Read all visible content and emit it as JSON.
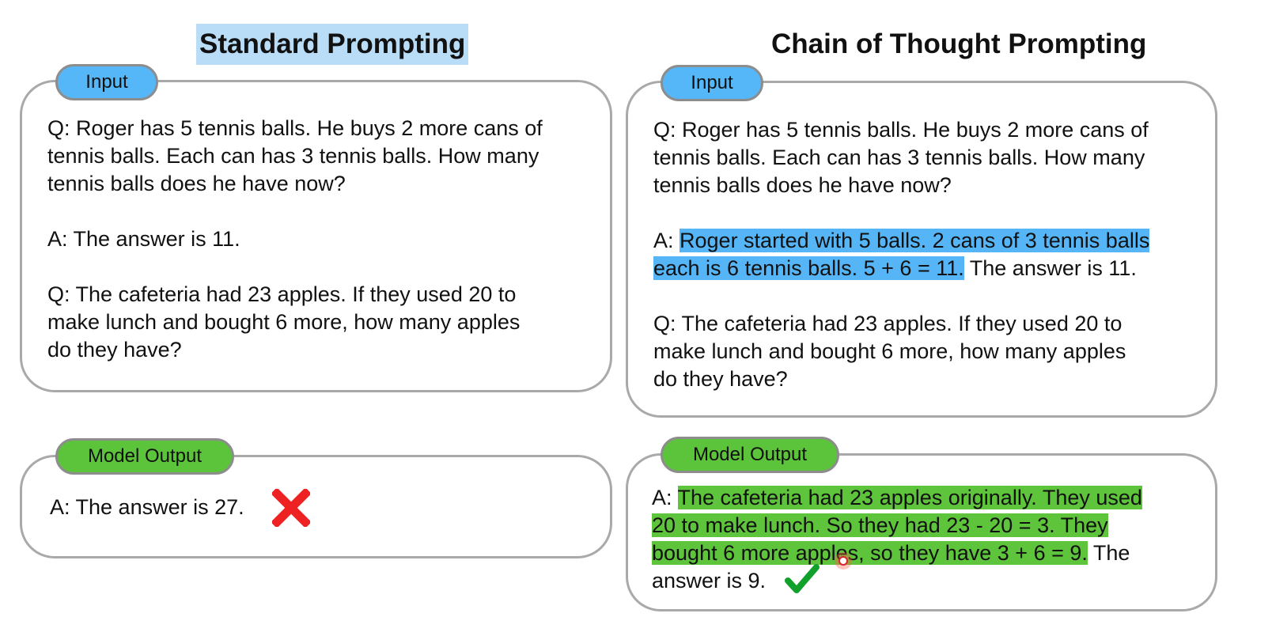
{
  "standard": {
    "title": "Standard Prompting",
    "title_highlight_color": "#b9dcf7",
    "input_tag": "Input",
    "input_lines": [
      "Q: Roger has 5 tennis balls. He buys 2 more cans of",
      "tennis balls. Each can has 3 tennis balls. How many",
      "tennis balls does he have now?",
      "",
      "A: The answer is 11.",
      "",
      "Q: The cafeteria had 23 apples. If they used 20 to",
      "make lunch and bought 6 more, how many apples",
      "do they have?"
    ],
    "output_tag": "Model Output",
    "output_text": "A: The answer is 27.",
    "output_mark_icon": "red-cross-icon"
  },
  "cot": {
    "title": "Chain of Thought Prompting",
    "input_tag": "Input",
    "q1_lines": [
      "Q: Roger has 5 tennis balls. He buys 2 more cans of",
      "tennis balls. Each can has 3 tennis balls. How many",
      "tennis balls does he have now?"
    ],
    "a1_prefix": "A: ",
    "a1_highlight_line1": "Roger started with 5 balls. 2 cans of 3 tennis balls",
    "a1_highlight_line2": "each is 6 tennis balls. 5 + 6 = 11.",
    "a1_suffix": " The answer is 11.",
    "q2_lines": [
      "Q: The cafeteria had 23 apples. If they used 20 to",
      "make lunch and bought 6 more, how many apples",
      "do they have?"
    ],
    "output_tag": "Model Output",
    "out_prefix": "A: ",
    "out_highlight_line1": "The cafeteria had 23 apples originally. They used",
    "out_highlight_line2": "20 to make lunch. So they had 23 - 20 = 3. They",
    "out_highlight_line3": "bought 6 more apples, so they have 3 + 6 = 9.",
    "out_suffix_line3": " The",
    "out_line4": "answer is 9.",
    "output_mark_icon": "green-check-icon"
  },
  "colors": {
    "input_tag": "#55b6f8",
    "output_tag": "#5bc43a",
    "highlight_blue": "#56b5f7",
    "highlight_green": "#5ec43c",
    "box_border": "#a9a9a9",
    "cross": "#ee2222",
    "check": "#12a02c"
  }
}
